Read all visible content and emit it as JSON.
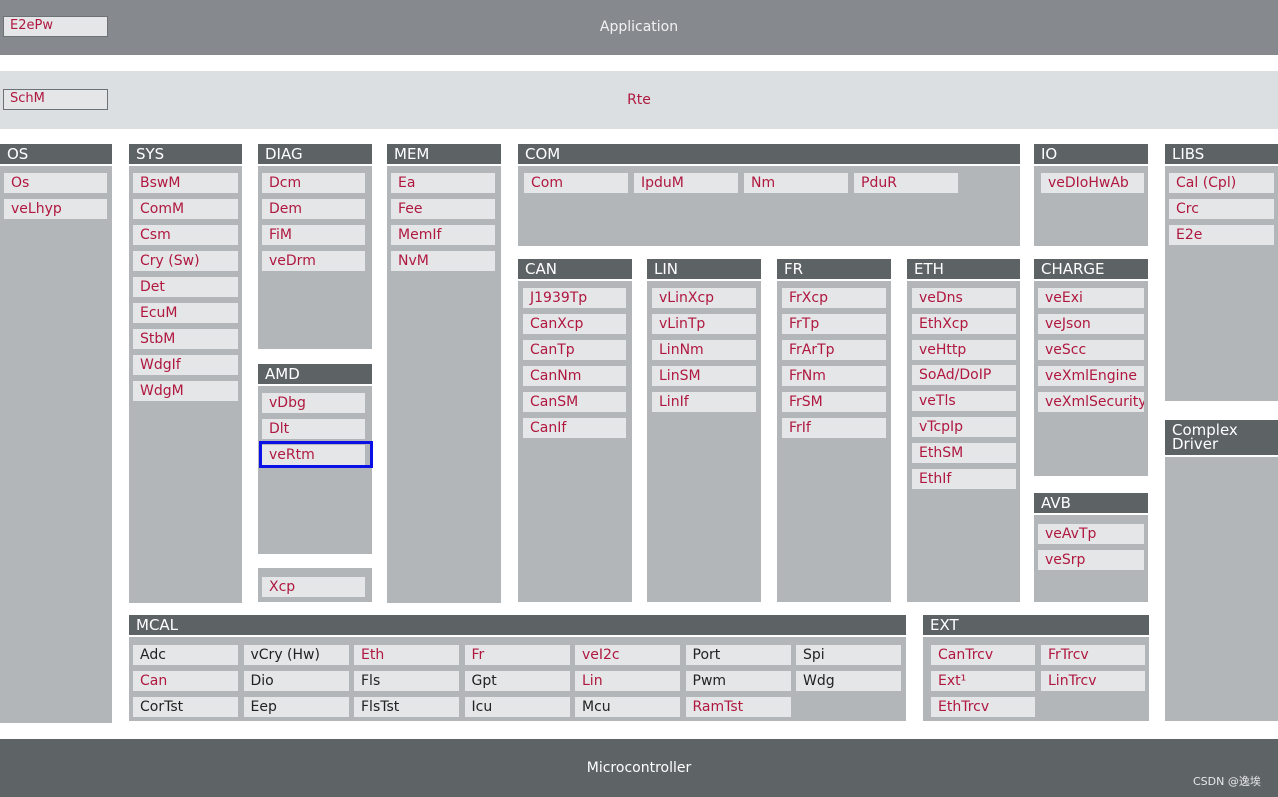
{
  "top": {
    "application": "Application",
    "e2epw": "E2ePw",
    "rte": "Rte",
    "schm": "SchM",
    "microcontroller": "Microcontroller"
  },
  "os": {
    "title": "OS",
    "items": [
      "Os",
      "veLhyp"
    ]
  },
  "sys": {
    "title": "SYS",
    "items": [
      "BswM",
      "ComM",
      "Csm",
      "Cry (Sw)",
      "Det",
      "EcuM",
      "StbM",
      "WdgIf",
      "WdgM"
    ]
  },
  "diag": {
    "title": "DIAG",
    "items": [
      "Dcm",
      "Dem",
      "FiM",
      "veDrm"
    ]
  },
  "amd": {
    "title": "AMD",
    "items": [
      "vDbg",
      "Dlt",
      "veRtm"
    ]
  },
  "xcp": {
    "items": [
      "Xcp"
    ]
  },
  "mem": {
    "title": "MEM",
    "items": [
      "Ea",
      "Fee",
      "MemIf",
      "NvM"
    ]
  },
  "com": {
    "title": "COM",
    "items": [
      "Com",
      "IpduM",
      "Nm",
      "PduR"
    ]
  },
  "can": {
    "title": "CAN",
    "items": [
      "J1939Tp",
      "CanXcp",
      "CanTp",
      "CanNm",
      "CanSM",
      "CanIf"
    ]
  },
  "lin": {
    "title": "LIN",
    "items": [
      "vLinXcp",
      "vLinTp",
      "LinNm",
      "LinSM",
      "LinIf"
    ]
  },
  "fr": {
    "title": "FR",
    "items": [
      "FrXcp",
      "FrTp",
      "FrArTp",
      "FrNm",
      "FrSM",
      "FrIf"
    ]
  },
  "eth": {
    "title": "ETH",
    "items": [
      "veDns",
      "EthXcp",
      "veHttp",
      "SoAd/DoIP",
      "veTls",
      "vTcpIp",
      "EthSM",
      "EthIf"
    ]
  },
  "io": {
    "title": "IO",
    "items": [
      "veDIoHwAb"
    ]
  },
  "charge": {
    "title": "CHARGE",
    "items": [
      "veExi",
      "veJson",
      "veScc",
      "veXmlEngine",
      "veXmlSecurity"
    ]
  },
  "avb": {
    "title": "AVB",
    "items": [
      "veAvTp",
      "veSrp"
    ]
  },
  "libs": {
    "title": "LIBS",
    "items": [
      "Cal (Cpl)",
      "Crc",
      "E2e"
    ]
  },
  "complex": {
    "title_line1": "Complex",
    "title_line2": "Driver"
  },
  "mcal": {
    "title": "MCAL",
    "rows": [
      [
        "Adc",
        "vCry (Hw)",
        "Eth",
        "Fr",
        "veI2c",
        "Port",
        "Spi"
      ],
      [
        "Can",
        "Dio",
        "Fls",
        "Gpt",
        "Lin",
        "Pwm",
        "Wdg"
      ],
      [
        "CorTst",
        "Eep",
        "FlsTst",
        "Icu",
        "Mcu",
        "RamTst"
      ]
    ],
    "red_items": [
      "Eth",
      "Fr",
      "veI2c",
      "Can",
      "Lin",
      "RamTst"
    ]
  },
  "ext": {
    "title": "EXT",
    "rows": [
      [
        "CanTrcv",
        "FrTrcv"
      ],
      [
        "Ext¹",
        "LinTrcv"
      ],
      [
        "EthTrcv"
      ]
    ]
  },
  "watermark": "CSDN @逸埃",
  "colors": {
    "module_text": "#b01840",
    "header_bg": "#5d6265",
    "column_bg": "#b3b6b9",
    "module_bg": "#e4e6e7",
    "highlight": "#0a10e6"
  }
}
